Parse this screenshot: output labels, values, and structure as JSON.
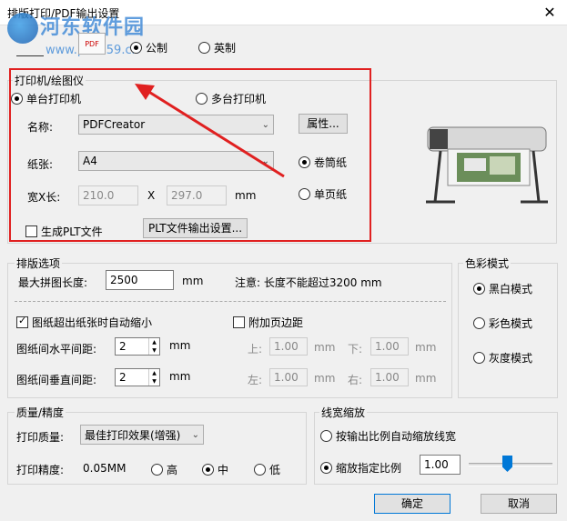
{
  "window": {
    "title": "排版打印/PDF输出设置",
    "close_icon": "close-icon"
  },
  "watermark": {
    "text": "河东软件园",
    "url": "www.pc0359.cn"
  },
  "units": {
    "metric": "公制",
    "imperial": "英制",
    "selected": "metric"
  },
  "printer_group": {
    "title": "打印机/绘图仪",
    "single": "单台打印机",
    "multi": "多台打印机",
    "name_label": "名称:",
    "name_value": "PDFCreator",
    "properties_button": "属性...",
    "paper_label": "纸张:",
    "paper_value": "A4",
    "roll_paper": "卷筒纸",
    "sheet_paper": "单页纸",
    "size_label": "宽X长:",
    "width": "210.0",
    "x_label": "X",
    "height": "297.0",
    "unit": "mm",
    "plt_checkbox": "生成PLT文件",
    "plt_button": "PLT文件输出设置..."
  },
  "layout_group": {
    "title": "排版选项",
    "max_len_label": "最大拼图长度:",
    "max_len_value": "2500",
    "max_len_unit": "mm",
    "note": "注意: 长度不能超过3200 mm",
    "auto_shrink": "图纸超出纸张时自动缩小",
    "add_margin": "附加页边距",
    "h_gap_label": "图纸间水平间距:",
    "h_gap_value": "2",
    "v_gap_label": "图纸间垂直间距:",
    "v_gap_value": "2",
    "gap_unit": "mm",
    "top_label": "上:",
    "top_value": "1.00",
    "bottom_label": "下:",
    "bottom_value": "1.00",
    "left_label": "左:",
    "left_value": "1.00",
    "right_label": "右:",
    "right_value": "1.00",
    "margin_unit": "mm"
  },
  "color_group": {
    "title": "色彩模式",
    "bw": "黑白模式",
    "color": "彩色模式",
    "gray": "灰度模式"
  },
  "quality_group": {
    "title": "质量/精度",
    "quality_label": "打印质量:",
    "quality_value": "最佳打印效果(增强)",
    "precision_label": "打印精度:",
    "precision_value": "0.05MM",
    "high": "高",
    "mid": "中",
    "low": "低"
  },
  "linewidth_group": {
    "title": "线宽缩放",
    "auto": "按输出比例自动缩放线宽",
    "fixed": "缩放指定比例",
    "fixed_value": "1.00"
  },
  "buttons": {
    "ok": "确定",
    "cancel": "取消"
  },
  "annotation": {
    "color": "#e02020"
  }
}
